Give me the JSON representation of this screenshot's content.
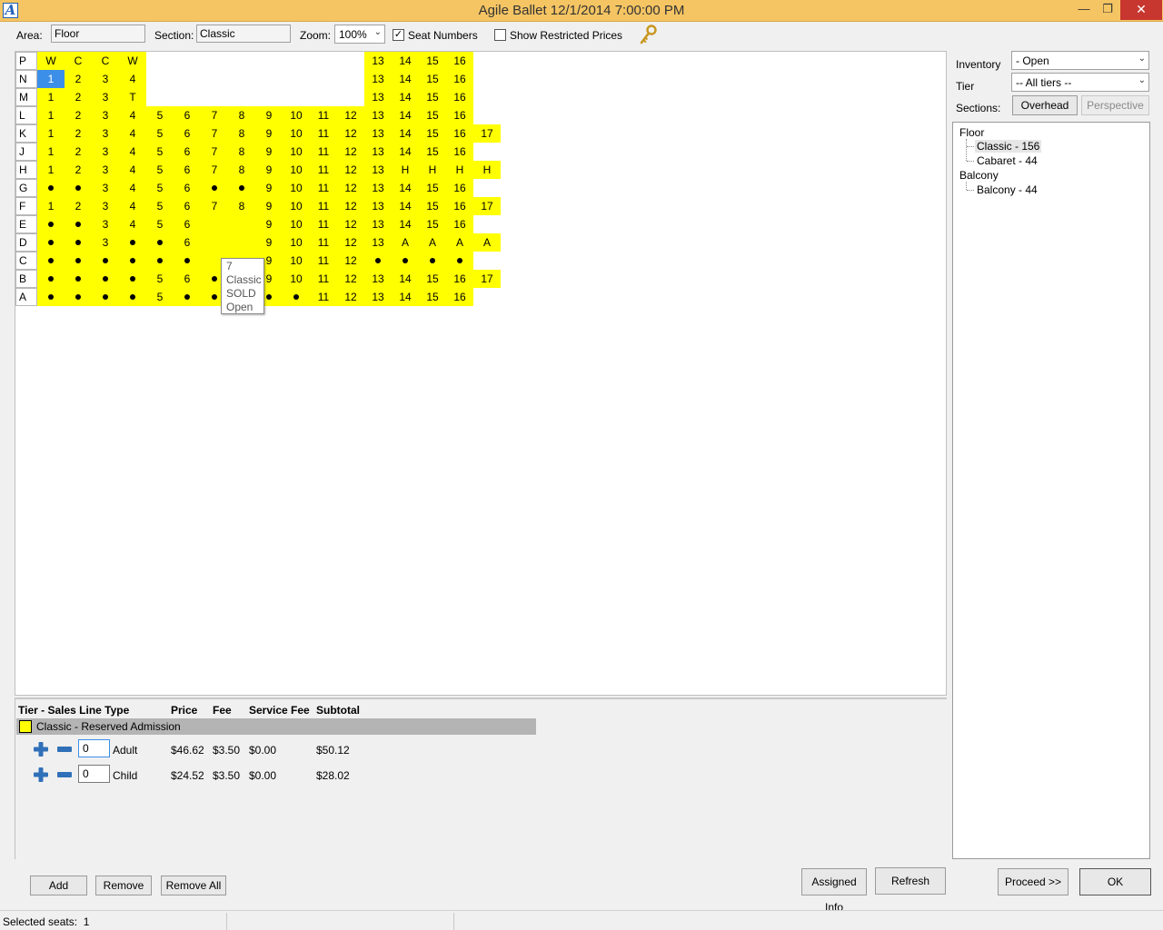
{
  "window": {
    "title": "Agile Ballet 12/1/2014 7:00:00 PM",
    "app_icon_letter": "A",
    "minimize_glyph": "—",
    "maximize_glyph": "❐",
    "close_glyph": "✕"
  },
  "toolbar": {
    "area_label": "Area:",
    "area_value": "Floor",
    "section_label": "Section:",
    "section_value": "Classic",
    "zoom_label": "Zoom:",
    "zoom_value": "100%",
    "seat_numbers_label": "Seat Numbers",
    "seat_numbers_checked": true,
    "restricted_label": "Show Restricted Prices",
    "restricted_checked": false
  },
  "seatmap": {
    "seat_color": "#ffff00",
    "selected_color": "#3c8fe8",
    "rows": [
      {
        "label": "P",
        "seats": [
          [
            "W",
            0
          ],
          [
            "C",
            1
          ],
          [
            "C",
            2
          ],
          [
            "W",
            3
          ],
          [
            "13",
            12
          ],
          [
            "14",
            13
          ],
          [
            "15",
            14
          ],
          [
            "16",
            15
          ]
        ]
      },
      {
        "label": "N",
        "seats": [
          [
            "1",
            0,
            "sel"
          ],
          [
            "2",
            1
          ],
          [
            "3",
            2
          ],
          [
            "4",
            3
          ],
          [
            "13",
            12
          ],
          [
            "14",
            13
          ],
          [
            "15",
            14
          ],
          [
            "16",
            15
          ]
        ]
      },
      {
        "label": "M",
        "seats": [
          [
            "1",
            0
          ],
          [
            "2",
            1
          ],
          [
            "3",
            2
          ],
          [
            "T",
            3
          ],
          [
            "13",
            12
          ],
          [
            "14",
            13
          ],
          [
            "15",
            14
          ],
          [
            "16",
            15
          ]
        ]
      },
      {
        "label": "L",
        "seats": [
          [
            "1",
            0
          ],
          [
            "2",
            1
          ],
          [
            "3",
            2
          ],
          [
            "4",
            3
          ],
          [
            "5",
            4
          ],
          [
            "6",
            5
          ],
          [
            "7",
            6
          ],
          [
            "8",
            7
          ],
          [
            "9",
            8
          ],
          [
            "10",
            9
          ],
          [
            "11",
            10
          ],
          [
            "12",
            11
          ],
          [
            "13",
            12
          ],
          [
            "14",
            13
          ],
          [
            "15",
            14
          ],
          [
            "16",
            15
          ]
        ]
      },
      {
        "label": "K",
        "seats": [
          [
            "1",
            0
          ],
          [
            "2",
            1
          ],
          [
            "3",
            2
          ],
          [
            "4",
            3
          ],
          [
            "5",
            4
          ],
          [
            "6",
            5
          ],
          [
            "7",
            6
          ],
          [
            "8",
            7
          ],
          [
            "9",
            8
          ],
          [
            "10",
            9
          ],
          [
            "11",
            10
          ],
          [
            "12",
            11
          ],
          [
            "13",
            12
          ],
          [
            "14",
            13
          ],
          [
            "15",
            14
          ],
          [
            "16",
            15
          ],
          [
            "17",
            16
          ]
        ]
      },
      {
        "label": "J",
        "seats": [
          [
            "1",
            0
          ],
          [
            "2",
            1
          ],
          [
            "3",
            2
          ],
          [
            "4",
            3
          ],
          [
            "5",
            4
          ],
          [
            "6",
            5
          ],
          [
            "7",
            6
          ],
          [
            "8",
            7
          ],
          [
            "9",
            8
          ],
          [
            "10",
            9
          ],
          [
            "11",
            10
          ],
          [
            "12",
            11
          ],
          [
            "13",
            12
          ],
          [
            "14",
            13
          ],
          [
            "15",
            14
          ],
          [
            "16",
            15
          ]
        ]
      },
      {
        "label": "H",
        "seats": [
          [
            "1",
            0
          ],
          [
            "2",
            1
          ],
          [
            "3",
            2
          ],
          [
            "4",
            3
          ],
          [
            "5",
            4
          ],
          [
            "6",
            5
          ],
          [
            "7",
            6
          ],
          [
            "8",
            7
          ],
          [
            "9",
            8
          ],
          [
            "10",
            9
          ],
          [
            "11",
            10
          ],
          [
            "12",
            11
          ],
          [
            "13",
            12
          ],
          [
            "H",
            13
          ],
          [
            "H",
            14
          ],
          [
            "H",
            15
          ],
          [
            "H",
            16
          ]
        ]
      },
      {
        "label": "G",
        "seats": [
          [
            "•",
            0
          ],
          [
            "•",
            1
          ],
          [
            "3",
            2
          ],
          [
            "4",
            3
          ],
          [
            "5",
            4
          ],
          [
            "6",
            5
          ],
          [
            "•",
            6
          ],
          [
            "•",
            7
          ],
          [
            "9",
            8
          ],
          [
            "10",
            9
          ],
          [
            "11",
            10
          ],
          [
            "12",
            11
          ],
          [
            "13",
            12
          ],
          [
            "14",
            13
          ],
          [
            "15",
            14
          ],
          [
            "16",
            15
          ]
        ]
      },
      {
        "label": "F",
        "seats": [
          [
            "1",
            0
          ],
          [
            "2",
            1
          ],
          [
            "3",
            2
          ],
          [
            "4",
            3
          ],
          [
            "5",
            4
          ],
          [
            "6",
            5
          ],
          [
            "7",
            6
          ],
          [
            "8",
            7
          ],
          [
            "9",
            8
          ],
          [
            "10",
            9
          ],
          [
            "11",
            10
          ],
          [
            "12",
            11
          ],
          [
            "13",
            12
          ],
          [
            "14",
            13
          ],
          [
            "15",
            14
          ],
          [
            "16",
            15
          ],
          [
            "17",
            16
          ]
        ]
      },
      {
        "label": "E",
        "seats": [
          [
            "•",
            0
          ],
          [
            "•",
            1
          ],
          [
            "3",
            2
          ],
          [
            "4",
            3
          ],
          [
            "5",
            4
          ],
          [
            "6",
            5
          ],
          [
            "",
            6
          ],
          [
            "",
            7
          ],
          [
            "9",
            8
          ],
          [
            "10",
            9
          ],
          [
            "11",
            10
          ],
          [
            "12",
            11
          ],
          [
            "13",
            12
          ],
          [
            "14",
            13
          ],
          [
            "15",
            14
          ],
          [
            "16",
            15
          ]
        ]
      },
      {
        "label": "D",
        "seats": [
          [
            "•",
            0
          ],
          [
            "•",
            1
          ],
          [
            "3",
            2
          ],
          [
            "•",
            3
          ],
          [
            "•",
            4
          ],
          [
            "6",
            5
          ],
          [
            "",
            6
          ],
          [
            "",
            7
          ],
          [
            "9",
            8
          ],
          [
            "10",
            9
          ],
          [
            "11",
            10
          ],
          [
            "12",
            11
          ],
          [
            "13",
            12
          ],
          [
            "A",
            13
          ],
          [
            "A",
            14
          ],
          [
            "A",
            15
          ],
          [
            "A",
            16
          ]
        ]
      },
      {
        "label": "C",
        "seats": [
          [
            "•",
            0
          ],
          [
            "•",
            1
          ],
          [
            "•",
            2
          ],
          [
            "•",
            3
          ],
          [
            "•",
            4
          ],
          [
            "•",
            5
          ],
          [
            "",
            6
          ],
          [
            "",
            7
          ],
          [
            "9",
            8
          ],
          [
            "10",
            9
          ],
          [
            "11",
            10
          ],
          [
            "12",
            11
          ],
          [
            "•",
            12
          ],
          [
            "•",
            13
          ],
          [
            "•",
            14
          ],
          [
            "•",
            15
          ]
        ]
      },
      {
        "label": "B",
        "seats": [
          [
            "•",
            0
          ],
          [
            "•",
            1
          ],
          [
            "•",
            2
          ],
          [
            "•",
            3
          ],
          [
            "5",
            4
          ],
          [
            "6",
            5
          ],
          [
            "•",
            6
          ],
          [
            "•",
            7
          ],
          [
            "9",
            8
          ],
          [
            "10",
            9
          ],
          [
            "11",
            10
          ],
          [
            "12",
            11
          ],
          [
            "13",
            12
          ],
          [
            "14",
            13
          ],
          [
            "15",
            14
          ],
          [
            "16",
            15
          ],
          [
            "17",
            16
          ]
        ]
      },
      {
        "label": "A",
        "seats": [
          [
            "•",
            0
          ],
          [
            "•",
            1
          ],
          [
            "•",
            2
          ],
          [
            "•",
            3
          ],
          [
            "5",
            4
          ],
          [
            "•",
            5
          ],
          [
            "•",
            6
          ],
          [
            "•",
            7
          ],
          [
            "•",
            8
          ],
          [
            "•",
            9
          ],
          [
            "11",
            10
          ],
          [
            "12",
            11
          ],
          [
            "13",
            12
          ],
          [
            "14",
            13
          ],
          [
            "15",
            14
          ],
          [
            "16",
            15
          ]
        ]
      }
    ],
    "tooltip": {
      "seat": "7",
      "section": "Classic",
      "status": "SOLD",
      "inventory": "Open"
    }
  },
  "sales": {
    "headers": {
      "tier": "Tier - Sales Line Type",
      "price": "Price",
      "fee": "Fee",
      "service_fee": "Service Fee",
      "subtotal": "Subtotal"
    },
    "tier_name": "Classic - Reserved Admission",
    "tier_color": "#ffff00",
    "lines": [
      {
        "qty": "0",
        "type": "Adult",
        "price": "$46.62",
        "fee": "$3.50",
        "service_fee": "$0.00",
        "subtotal": "$50.12"
      },
      {
        "qty": "0",
        "type": "Child",
        "price": "$24.52",
        "fee": "$3.50",
        "service_fee": "$0.00",
        "subtotal": "$28.02"
      }
    ],
    "add_label": "Add",
    "remove_label": "Remove",
    "remove_all_label": "Remove All"
  },
  "right_panel": {
    "inventory_label": "Inventory",
    "inventory_value": "- Open",
    "tier_label": "Tier",
    "tier_value": "-- All tiers --",
    "sections_label": "Sections:",
    "overhead_label": "Overhead",
    "perspective_label": "Perspective",
    "tree": {
      "floor": "Floor",
      "classic": "Classic - 156",
      "cabaret": "Cabaret - 44",
      "balcony_group": "Balcony",
      "balcony": "Balcony - 44"
    }
  },
  "footer_buttons": {
    "assigned_info": "Assigned Info",
    "refresh": "Refresh",
    "proceed": "Proceed >>",
    "ok": "OK"
  },
  "status": {
    "selected_seats_label": "Selected seats:",
    "selected_seats_count": "1"
  }
}
